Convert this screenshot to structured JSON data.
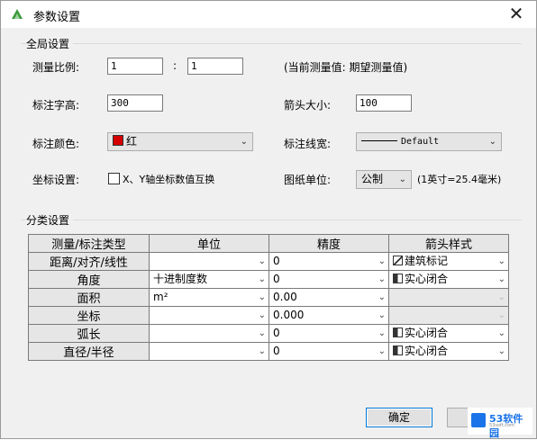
{
  "window": {
    "title": "参数设置",
    "close_symbol": "✕"
  },
  "global": {
    "group_title": "全局设置",
    "scale_label": "测量比例:",
    "scale_left": "1",
    "scale_sep": ":",
    "scale_right": "1",
    "scale_note": "(当前测量值: 期望测量值)",
    "text_height_label": "标注字高:",
    "text_height": "300",
    "arrow_size_label": "箭头大小:",
    "arrow_size": "100",
    "color_label": "标注颜色:",
    "color_value": "红",
    "color_hex": "#d40000",
    "linewidth_label": "标注线宽:",
    "linewidth_value": "Default",
    "coord_label": "坐标设置:",
    "coord_checkbox": "X、Y轴坐标数值互换",
    "coord_checked": false,
    "paper_unit_label": "图纸单位:",
    "paper_unit_value": "公制",
    "paper_unit_note": "(1英寸=25.4毫米)"
  },
  "category": {
    "group_title": "分类设置",
    "columns": [
      "测量/标注类型",
      "单位",
      "精度",
      "箭头样式"
    ],
    "rows": [
      {
        "type": "距离/对齐/线性",
        "unit": "",
        "unit_enabled": true,
        "precision": "0",
        "arrow": "建筑标记",
        "arrow_icon": "oblique-tick-icon",
        "arrow_enabled": true
      },
      {
        "type": "角度",
        "unit": "十进制度数",
        "unit_enabled": true,
        "precision": "0",
        "arrow": "实心闭合",
        "arrow_icon": "closed-filled-arrow-icon",
        "arrow_enabled": true
      },
      {
        "type": "面积",
        "unit": "m²",
        "unit_enabled": true,
        "precision": "0.00",
        "arrow": "",
        "arrow_icon": "",
        "arrow_enabled": false
      },
      {
        "type": "坐标",
        "unit": "",
        "unit_enabled": true,
        "precision": "0.000",
        "arrow": "",
        "arrow_icon": "",
        "arrow_enabled": false
      },
      {
        "type": "弧长",
        "unit": "",
        "unit_enabled": true,
        "precision": "0",
        "arrow": "实心闭合",
        "arrow_icon": "closed-filled-arrow-icon",
        "arrow_enabled": true
      },
      {
        "type": "直径/半径",
        "unit": "",
        "unit_enabled": true,
        "precision": "0",
        "arrow": "实心闭合",
        "arrow_icon": "closed-filled-arrow-icon",
        "arrow_enabled": true
      }
    ]
  },
  "buttons": {
    "ok": "确定"
  },
  "watermark": {
    "text": "53软件园",
    "url": "53soft.com"
  }
}
